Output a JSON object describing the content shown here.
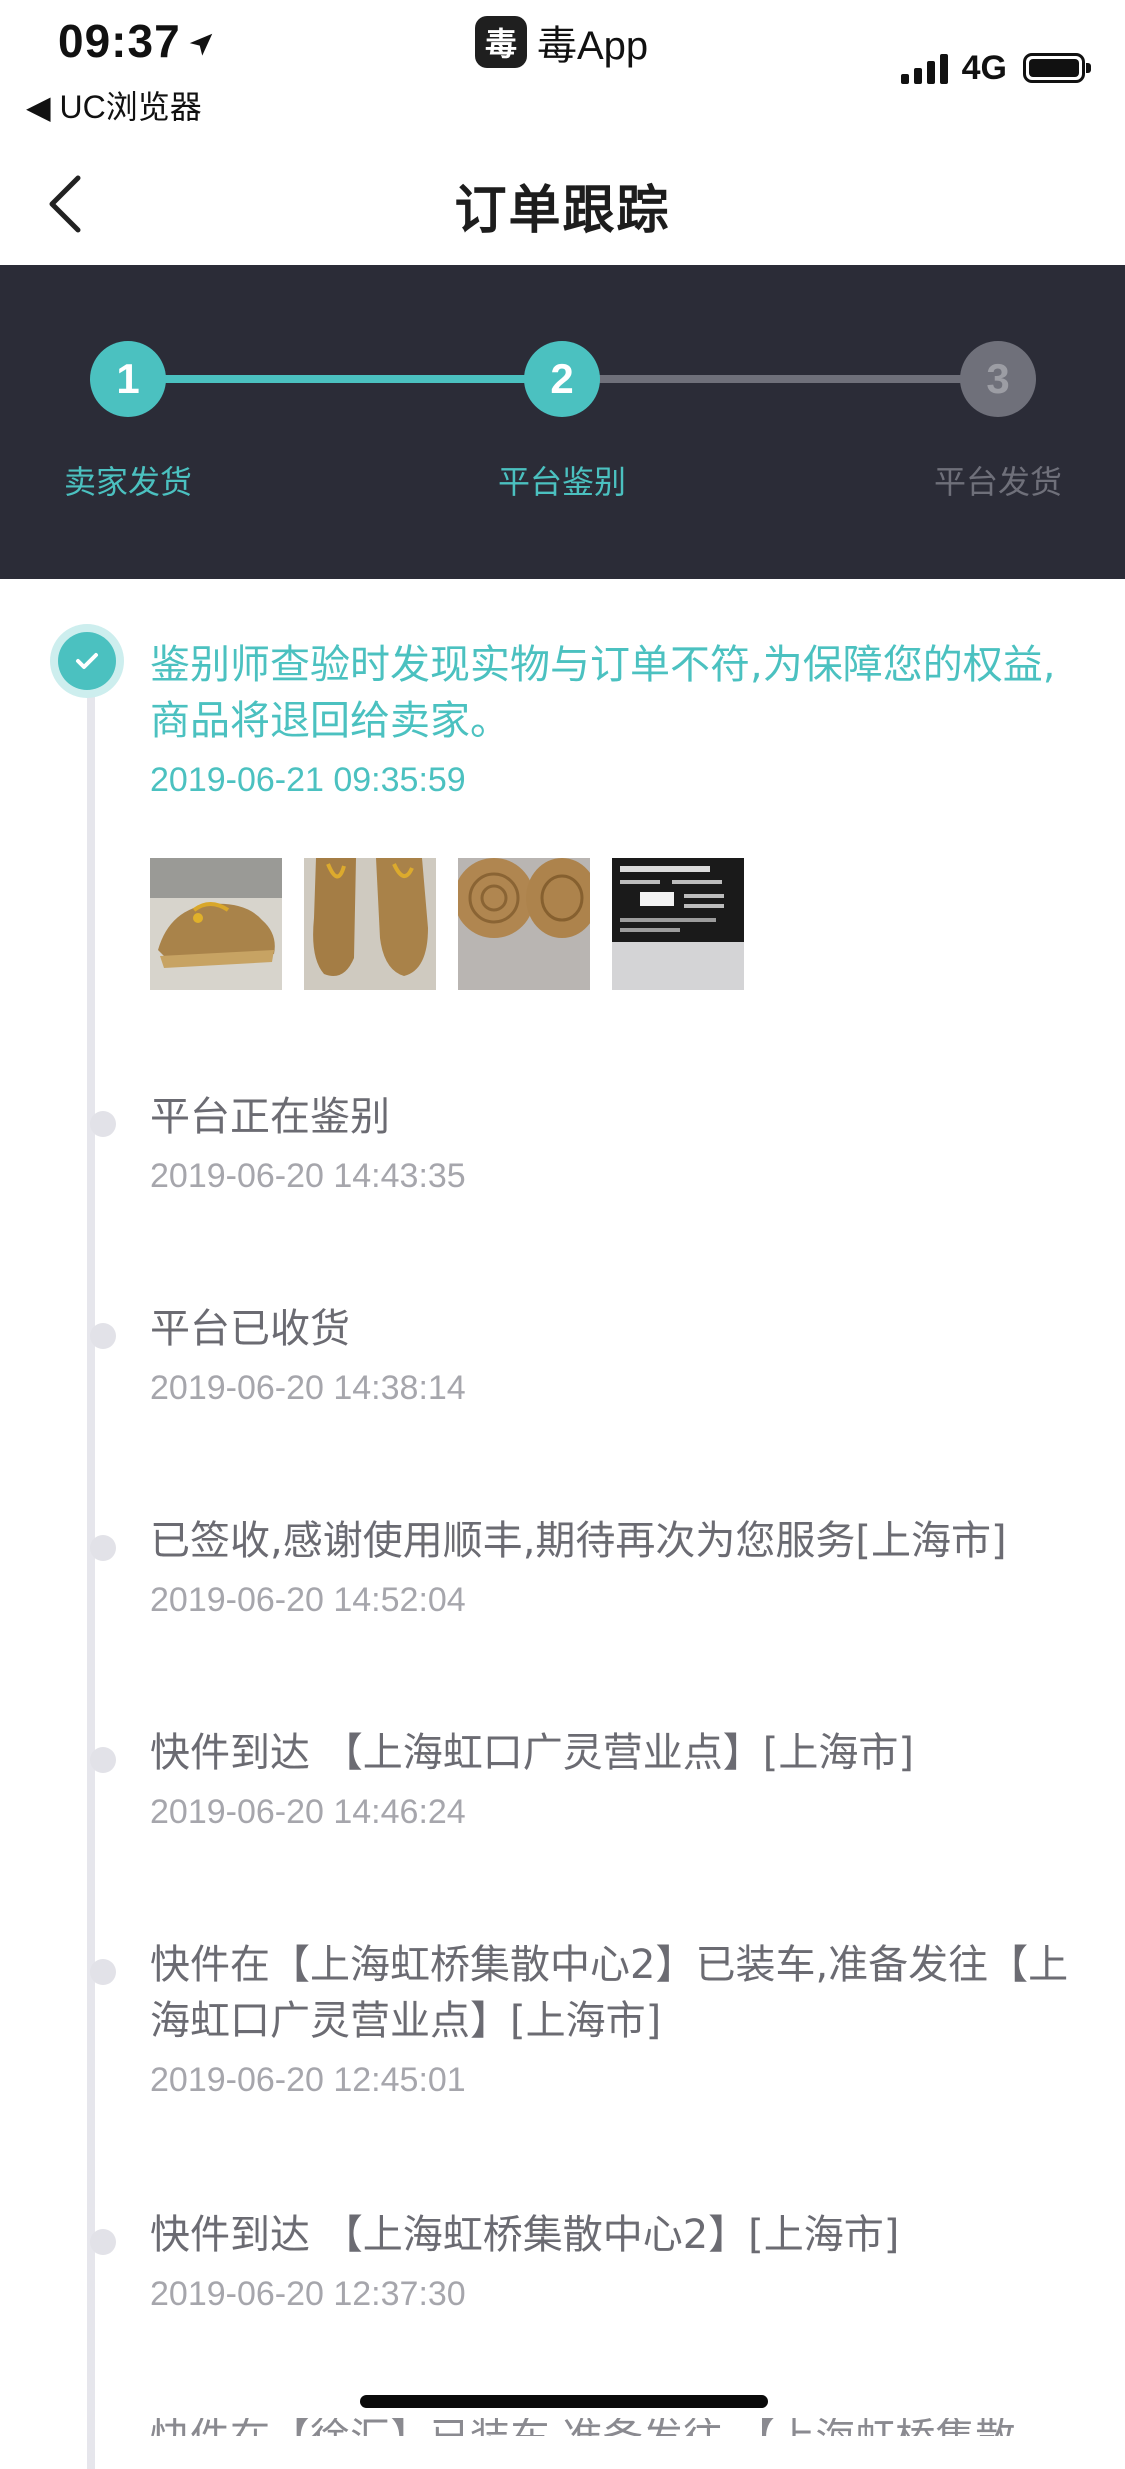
{
  "status_bar": {
    "time": "09:37",
    "back_app": "◀ UC浏览器",
    "app_name": "毒App",
    "app_icon_char": "毒",
    "network": "4G",
    "icons": [
      "location-arrow-icon",
      "signal-icon",
      "battery-icon"
    ]
  },
  "nav": {
    "title": "订单跟踪",
    "back_icon": "chevron-left-icon"
  },
  "progress": {
    "steps": [
      {
        "number": "1",
        "label": "卖家发货",
        "state": "done"
      },
      {
        "number": "2",
        "label": "平台鉴别",
        "state": "current"
      },
      {
        "number": "3",
        "label": "平台发货",
        "state": "pending"
      }
    ],
    "colors": {
      "active": "#4bc1c0",
      "inactive": "#6f707a",
      "band": "#2b2c37"
    }
  },
  "timeline": [
    {
      "text": "鉴别师查验时发现实物与订单不符,为保障您的权益,商品将退回给卖家。",
      "time": "2019-06-21 09:35:59",
      "highlighted": true,
      "photos": [
        "sneaker-side-photo",
        "sneaker-top-photo",
        "sneaker-sole-photo",
        "shoe-box-label-photo"
      ]
    },
    {
      "text": "平台正在鉴别",
      "time": "2019-06-20 14:43:35"
    },
    {
      "text": "平台已收货",
      "time": "2019-06-20 14:38:14"
    },
    {
      "text": "已签收,感谢使用顺丰,期待再次为您服务[上海市]",
      "time": "2019-06-20 14:52:04"
    },
    {
      "text": "快件到达 【上海虹口广灵营业点】[上海市]",
      "time": "2019-06-20 14:46:24"
    },
    {
      "text": "快件在【上海虹桥集散中心2】已装车,准备发往【上海虹口广灵营业点】[上海市]",
      "time": "2019-06-20 12:45:01"
    },
    {
      "text": "快件到达 【上海虹桥集散中心2】[上海市]",
      "time": "2019-06-20 12:37:30"
    }
  ],
  "cut_off_text": "快件在【徐汇】已装车,准备发往 【上海虹桥集散"
}
